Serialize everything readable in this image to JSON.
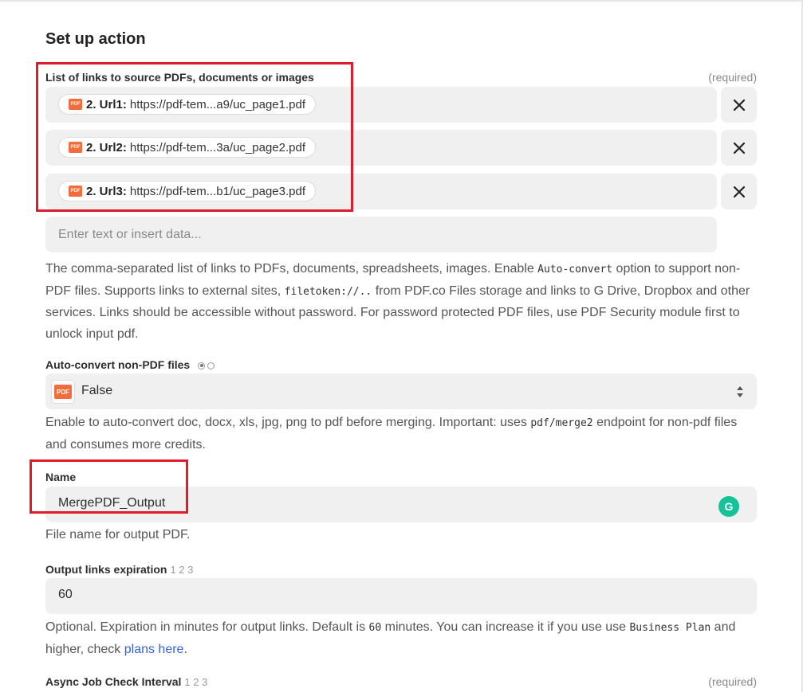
{
  "heading": "Set up action",
  "required_text": "(required)",
  "source_links": {
    "label": "List of links to source PDFs, documents or images",
    "items": [
      {
        "step": "2. Url1:",
        "value": "https://pdf-tem...a9/uc_page1.pdf"
      },
      {
        "step": "2. Url2:",
        "value": "https://pdf-tem...3a/uc_page2.pdf"
      },
      {
        "step": "2. Url3:",
        "value": "https://pdf-tem...b1/uc_page3.pdf"
      }
    ],
    "placeholder": "Enter text or insert data...",
    "description": {
      "p1": "The comma-separated list of links to PDFs, documents, spreadsheets, images. Enable ",
      "code1": "Auto-convert",
      "p2": " option to support non-PDF files. Supports links to external sites, ",
      "code2": "filetoken://..",
      "p3": " from PDF.co Files storage and links to G Drive, Dropbox and other services. Links should be accessible without password. For password protected PDF files, use PDF Security module first to unlock input pdf."
    }
  },
  "auto_convert": {
    "label": "Auto-convert non-PDF files",
    "value": "False",
    "description": {
      "p1": "Enable to auto-convert doc, docx, xls, jpg, png to pdf before merging. Important: uses ",
      "code1": "pdf/merge2",
      "p2": " endpoint for non-pdf files and consumes more credits."
    }
  },
  "name_field": {
    "label": "Name",
    "value": "MergePDF_Output",
    "description": "File name for output PDF."
  },
  "expiration": {
    "label": "Output links expiration",
    "hint": "1 2 3",
    "value": "60",
    "description": {
      "p1": "Optional. Expiration in minutes for output links. Default is ",
      "code1": "60",
      "p2": " minutes. You can increase it if you use use ",
      "code2": "Business Plan",
      "p3": " and higher, check ",
      "link": "plans here",
      "p4": "."
    }
  },
  "async_interval": {
    "label": "Async Job Check Interval",
    "hint": "1 2 3"
  },
  "icons": {
    "pdf": "PDF",
    "grammarly": "G"
  },
  "colors": {
    "highlight": "#e01b2c",
    "pdf_brand": "#f26d3d",
    "link": "#3863d4",
    "grammarly": "#15c39a"
  }
}
